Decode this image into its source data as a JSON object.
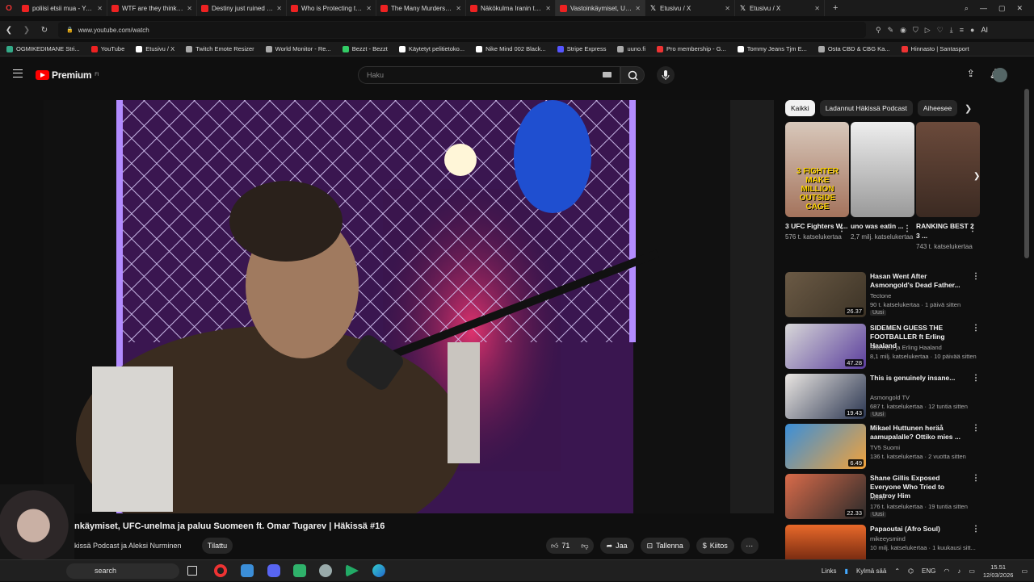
{
  "browser": {
    "tabs": [
      {
        "title": "poliisi etsii mua - YouTube",
        "icon": "youtube-icon"
      },
      {
        "title": "WTF are they thinking? - Y",
        "icon": "youtube-icon"
      },
      {
        "title": "Destiny just ruined his ca",
        "icon": "youtube-icon"
      },
      {
        "title": "Who is Protecting the Jeffr",
        "icon": "youtube-icon"
      },
      {
        "title": "The Many Murders of Jeff",
        "icon": "youtube-icon"
      },
      {
        "title": "Näkökulma Iranin tapahtu",
        "icon": "youtube-icon"
      },
      {
        "title": "Vastoinkäymiset, UFC",
        "icon": "youtube-icon",
        "active": true
      },
      {
        "title": "Etusivu / X",
        "icon": "x-icon"
      },
      {
        "title": "Etusivu / X",
        "icon": "x-icon"
      }
    ],
    "url": "www.youtube.com/watch",
    "bookmarks": [
      "OGMIKEDIMANE Stri...",
      "YouTube",
      "Etusivu / X",
      "Twitch Emote Resizer",
      "World Monitor - Re...",
      "Bezzt - Bezzt",
      "Käytetyt pelitietoko...",
      "Nike Mind 002 Black...",
      "Stripe Express",
      "uuno.fi",
      "Pro membership - G...",
      "Tommy Jeans Tjm E...",
      "Osta CBD & CBG Ka...",
      "Hinnasto | Santasport"
    ],
    "ai_label": "AI"
  },
  "header": {
    "logo_text": "Premium",
    "logo_sup": "FI",
    "search_placeholder": "Haku"
  },
  "video": {
    "title": "nkäymiset, UFC-unelma ja paluu Suomeen ft. Omar Tugarev | Häkissä #16",
    "channel": "kissä Podcast ja Aleksi Nurminen",
    "subscribe_label": "Tilattu",
    "likes": "71",
    "share_label": "Jaa",
    "save_label": "Tallenna",
    "thanks_label": "Kiitos"
  },
  "chips": [
    "Kaikki",
    "Ladannut Häkissä Podcast",
    "Aiheesee"
  ],
  "shorts": [
    {
      "title": "3 UFC Fighters W...",
      "views": "576 t. katselukertaa",
      "thumb_text": "3 FIGHTER MAKE MILLION OUTSIDE CAGE"
    },
    {
      "title": "uno was eatin ...",
      "views": "2,7 milj. katselukertaa"
    },
    {
      "title": "RANKING BEST 2 3 ...",
      "views": "743 t. katselukertaa"
    }
  ],
  "recommended": [
    {
      "title": "Hasan Went After Asmongold's Dead Father...",
      "channel": "Tectone",
      "views": "90 t. katselukertaa · 1 päivä sitten",
      "duration": "26.37",
      "badge": "Uusi"
    },
    {
      "title": "SIDEMEN GUESS THE FOOTBALLER ft Erling Haaland",
      "channel": "Sidemen ja Erling Haaland",
      "views": "8,1 milj. katselukertaa · 10 päivää sitten",
      "duration": "47.28",
      "badge": ""
    },
    {
      "title": "This is genuinely insane...",
      "channel": "Asmongold TV",
      "views": "687 t. katselukertaa · 12 tuntia sitten",
      "duration": "19.43",
      "badge": "Uusi"
    },
    {
      "title": "Mikael Huttunen heräå aamupalalle? Ottiko mies ...",
      "channel": "TV5 Suomi",
      "views": "136 t. katselukertaa · 2 vuotta sitten",
      "duration": "6.49",
      "badge": ""
    },
    {
      "title": "Shane Gillis Exposed Everyone Who Tried to Destroy Him",
      "channel": "Moon",
      "views": "176 t. katselukertaa · 19 tuntia sitten",
      "duration": "22.33",
      "badge": "Uusi"
    },
    {
      "title": "Papaoutai (Afro Soul)",
      "channel": "mikeeysmind",
      "views": "10 milj. katselukertaa · 1 kuukausi sitt...",
      "duration": "",
      "badge": ""
    }
  ],
  "taskbar": {
    "search_placeholder": "search",
    "links_label": "Links",
    "weather": "Kylmä sää",
    "lang": "ENG",
    "time": "15.51",
    "date": "12/03/2026"
  }
}
